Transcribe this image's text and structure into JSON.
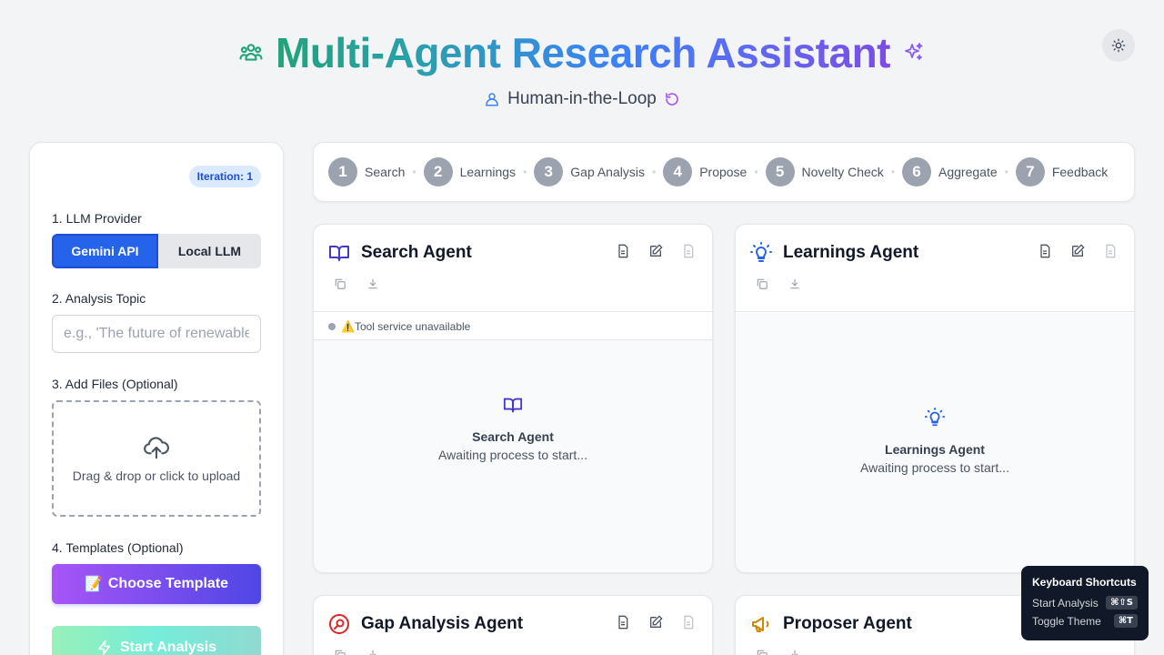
{
  "header": {
    "title": "Multi-Agent Research Assistant",
    "subtitle": "Human-in-the-Loop",
    "colors": {
      "teal": "#22a37a",
      "blue": "#3b82f6",
      "purple": "#7c4ce6"
    }
  },
  "sidebar": {
    "iteration": "Iteration: 1",
    "llm_label": "1. LLM Provider",
    "providers": [
      "Gemini API",
      "Local LLM"
    ],
    "selected_provider": "Gemini API",
    "topic_label": "2. Analysis Topic",
    "topic_placeholder": "e.g., 'The future of renewable energy'",
    "topic_value": "",
    "files_label": "3. Add Files (Optional)",
    "upload_text": "Drag & drop or click to upload",
    "templates_label": "4. Templates (Optional)",
    "template_button": "Choose Template",
    "template_emoji": "📝",
    "start_button": "Start Analysis"
  },
  "steps": [
    {
      "num": "1",
      "label": "Search"
    },
    {
      "num": "2",
      "label": "Learnings"
    },
    {
      "num": "3",
      "label": "Gap Analysis"
    },
    {
      "num": "4",
      "label": "Propose"
    },
    {
      "num": "5",
      "label": "Novelty Check"
    },
    {
      "num": "6",
      "label": "Aggregate"
    },
    {
      "num": "7",
      "label": "Feedback"
    }
  ],
  "agents": {
    "search": {
      "title": "Search Agent",
      "status": "⚠️Tool service unavailable",
      "placeholder_title": "Search Agent",
      "placeholder_sub": "Awaiting process to start...",
      "icon": "book-icon",
      "color": "#4338ca"
    },
    "learnings": {
      "title": "Learnings Agent",
      "placeholder_title": "Learnings Agent",
      "placeholder_sub": "Awaiting process to start...",
      "icon": "lightbulb-icon",
      "color": "#2563eb"
    },
    "gap": {
      "title": "Gap Analysis Agent",
      "icon": "search-circle-icon",
      "color": "#dc2626"
    },
    "proposer": {
      "title": "Proposer Agent",
      "icon": "megaphone-icon",
      "color": "#ca8a04"
    }
  },
  "shortcuts": {
    "title": "Keyboard Shortcuts",
    "items": [
      {
        "label": "Start Analysis",
        "keys": "⌘⇧S"
      },
      {
        "label": "Toggle Theme",
        "keys": "⌘T"
      }
    ]
  }
}
